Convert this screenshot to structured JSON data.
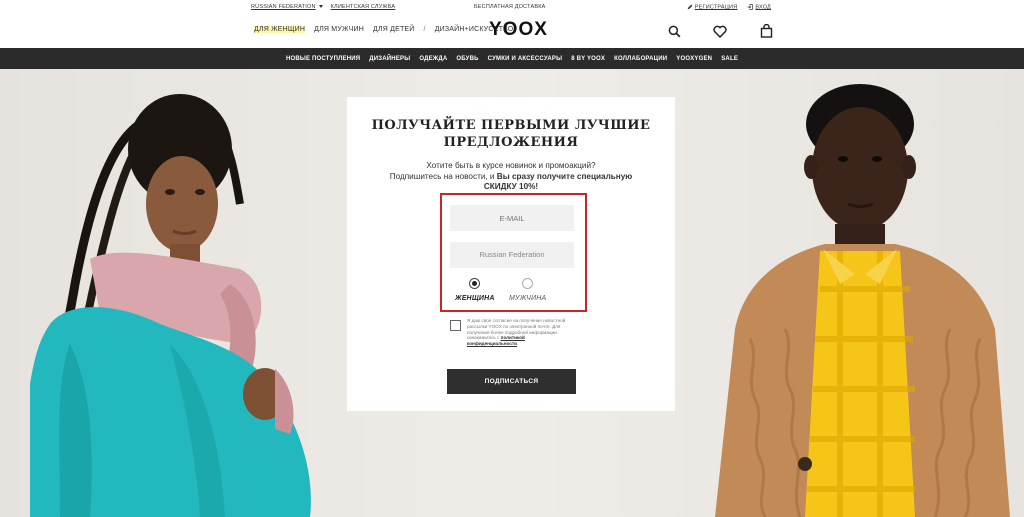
{
  "utility": {
    "country": "RUSSIAN FEDERATION",
    "customer_service": "КЛИЕНТСКАЯ СЛУЖБА",
    "free_delivery": "БЕСПЛАТНАЯ ДОСТАВКА",
    "register": "РЕГИСТРАЦИЯ",
    "login": "ВХОД"
  },
  "header": {
    "logo": "YOOX",
    "gender_nav": [
      {
        "label": "ДЛЯ ЖЕНЩИН",
        "active": true
      },
      {
        "label": "ДЛЯ МУЖЧИН",
        "active": false
      },
      {
        "label": "ДЛЯ ДЕТЕЙ",
        "active": false
      },
      {
        "label": "ДИЗАЙН+ИСКУССТВО",
        "active": false
      }
    ],
    "separator": "/",
    "icons": [
      "search-icon",
      "heart-icon",
      "shopping-bag-icon"
    ]
  },
  "categories": [
    "НОВЫЕ ПОСТУПЛЕНИЯ",
    "ДИЗАЙНЕРЫ",
    "ОДЕЖДА",
    "ОБУВЬ",
    "СУМКИ И АКСЕССУАРЫ",
    "8 BY YOOX",
    "КОЛЛАБОРАЦИИ",
    "YOOXYGEN",
    "SALE"
  ],
  "newsletter": {
    "title_line1": "ПОЛУЧАЙТЕ ПЕРВЫМИ ЛУЧШИЕ",
    "title_line2": "ПРЕДЛОЖЕНИЯ",
    "sub_line1": "Хотите быть в курсе новинок и промоакций?",
    "sub_line2_regular": "Подпишитесь на новости, и ",
    "sub_line2_bold": "Вы сразу получите специальную",
    "sub_line3": "СКИДКУ 10%!",
    "email_placeholder": "E-MAIL",
    "country_value": "Russian Federation",
    "gender_women": "ЖЕНЩИНА",
    "gender_men": "МУЖЧИНА",
    "selected_gender": "women",
    "consent_text": "Я даю свое согласие на получение новостной рассылки YOOX по электронной почте. Для получения более подробной информации ознакомьтесь с ",
    "consent_link": "политикой конфиденциальности",
    "consent_end": ".",
    "subscribe": "ПОДПИСАТЬСЯ"
  },
  "colors": {
    "highlight_border": "#c8242b",
    "nav_bg": "#2b2b2b",
    "active_gender_bg": "#fff7a8"
  }
}
